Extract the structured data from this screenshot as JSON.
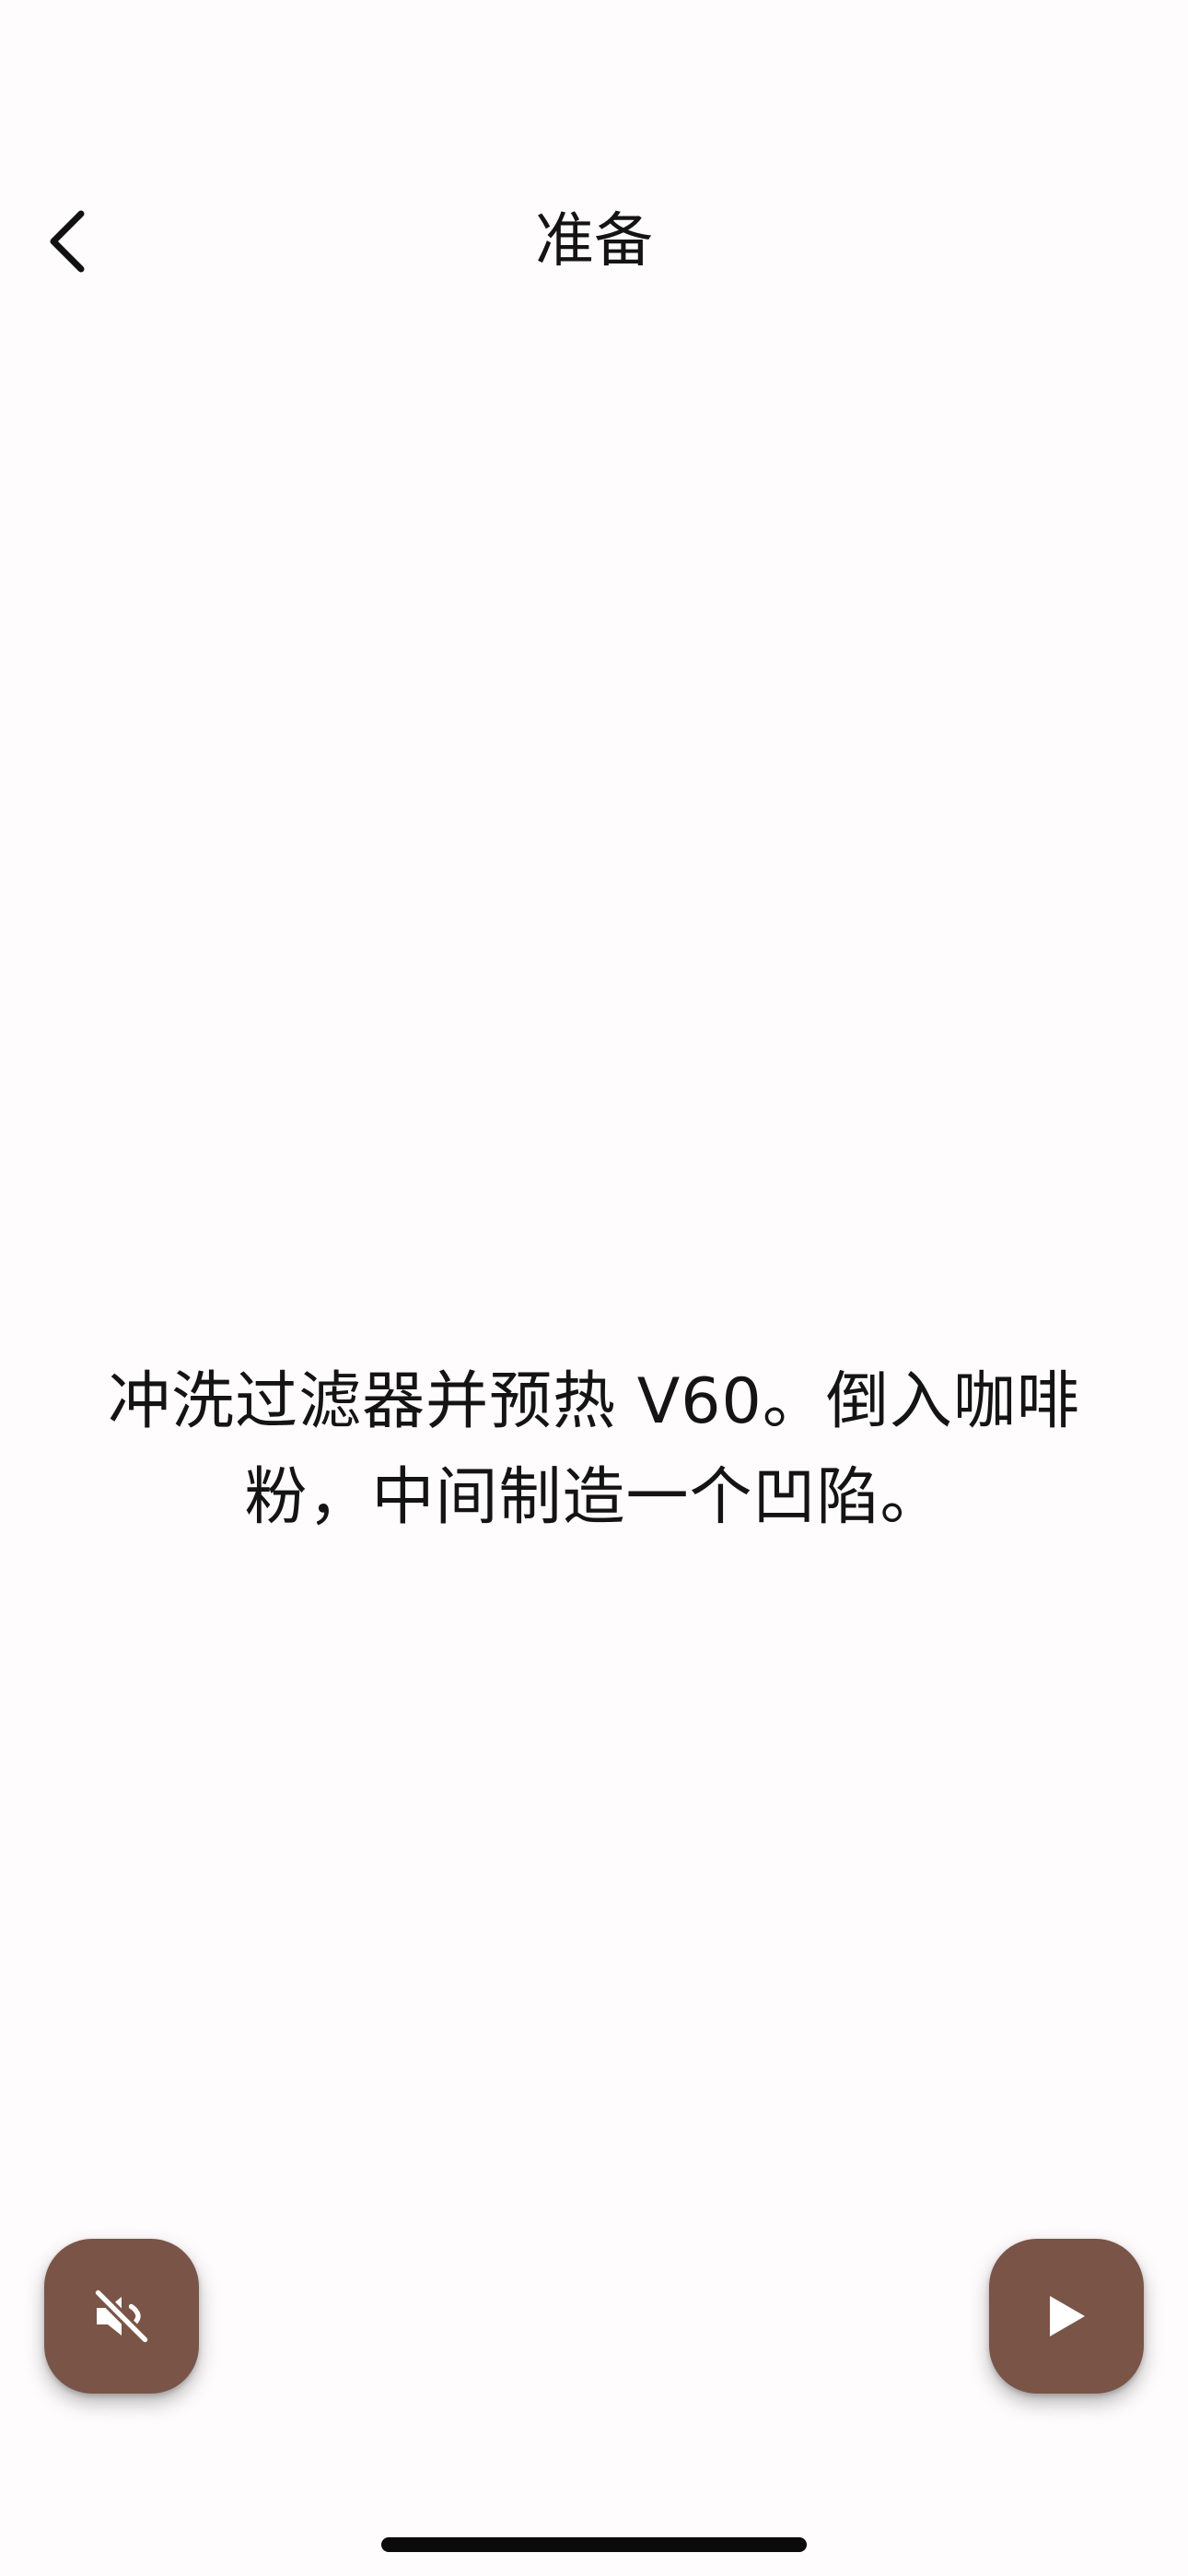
{
  "header": {
    "title": "准备",
    "back_icon": "chevron-left-icon"
  },
  "main": {
    "instruction": "冲洗过滤器并预热 V60。倒入咖啡粉，中间制造一个凹陷。"
  },
  "controls": {
    "mute_icon": "volume-off-icon",
    "play_icon": "play-icon",
    "button_color": "#7a5447"
  }
}
